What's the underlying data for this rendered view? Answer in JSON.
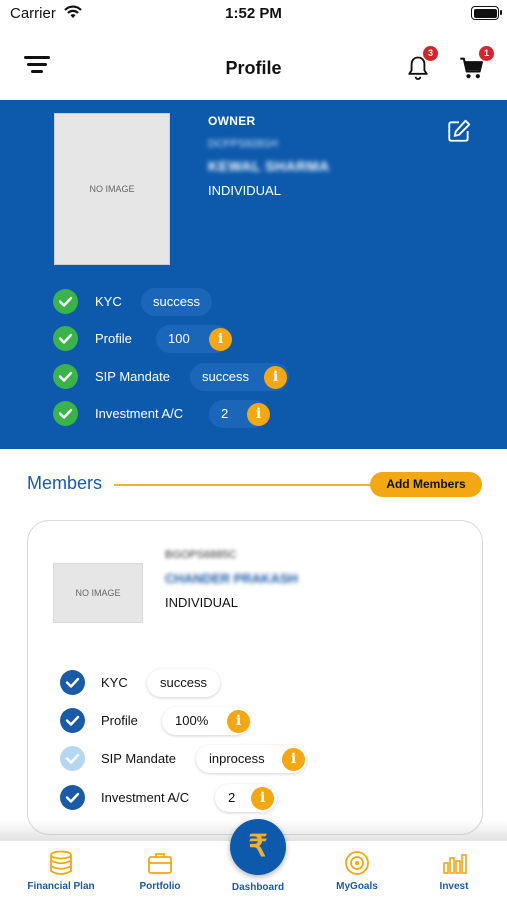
{
  "status_bar": {
    "carrier": "Carrier",
    "time": "1:52 PM"
  },
  "header": {
    "title": "Profile",
    "notifications_count": "3",
    "cart_count": "1"
  },
  "owner": {
    "photo_placeholder": "NO IMAGE",
    "role": "OWNER",
    "pan": "DCFPS9281H",
    "name": "KEWAL SHARMA",
    "type": "INDIVIDUAL",
    "statuses": [
      {
        "label": "KYC",
        "value": "success",
        "info": false
      },
      {
        "label": "Profile",
        "value": "100",
        "info": true
      },
      {
        "label": "SIP Mandate",
        "value": "success",
        "info": true
      },
      {
        "label": "Investment A/C",
        "value": "2",
        "info": true
      }
    ]
  },
  "members": {
    "title": "Members",
    "add_label": "Add Members",
    "list": [
      {
        "photo_placeholder": "NO IMAGE",
        "pan": "BGOPS6885C",
        "name": "CHANDER PRAKASH",
        "type": "INDIVIDUAL",
        "statuses": [
          {
            "label": "KYC",
            "value": "success",
            "info": false,
            "complete": true
          },
          {
            "label": "Profile",
            "value": "100%",
            "info": true,
            "complete": true
          },
          {
            "label": "SIP Mandate",
            "value": "inprocess",
            "info": true,
            "complete": false
          },
          {
            "label": "Investment A/C",
            "value": "2",
            "info": true,
            "complete": true
          }
        ]
      }
    ]
  },
  "info_glyph": "i",
  "tabs": [
    {
      "label": "Financial Plan",
      "icon": "coins-icon"
    },
    {
      "label": "Portfolio",
      "icon": "briefcase-icon"
    },
    {
      "label": "Dashboard",
      "icon": "rupee-icon",
      "glyph": "₹"
    },
    {
      "label": "MyGoals",
      "icon": "target-icon"
    },
    {
      "label": "Invest",
      "icon": "bar-chart-icon"
    }
  ],
  "colors": {
    "primary_blue": "#0d5aad",
    "accent_orange": "#f3a712",
    "success_green": "#3bb24a",
    "badge_red": "#d8232a"
  }
}
